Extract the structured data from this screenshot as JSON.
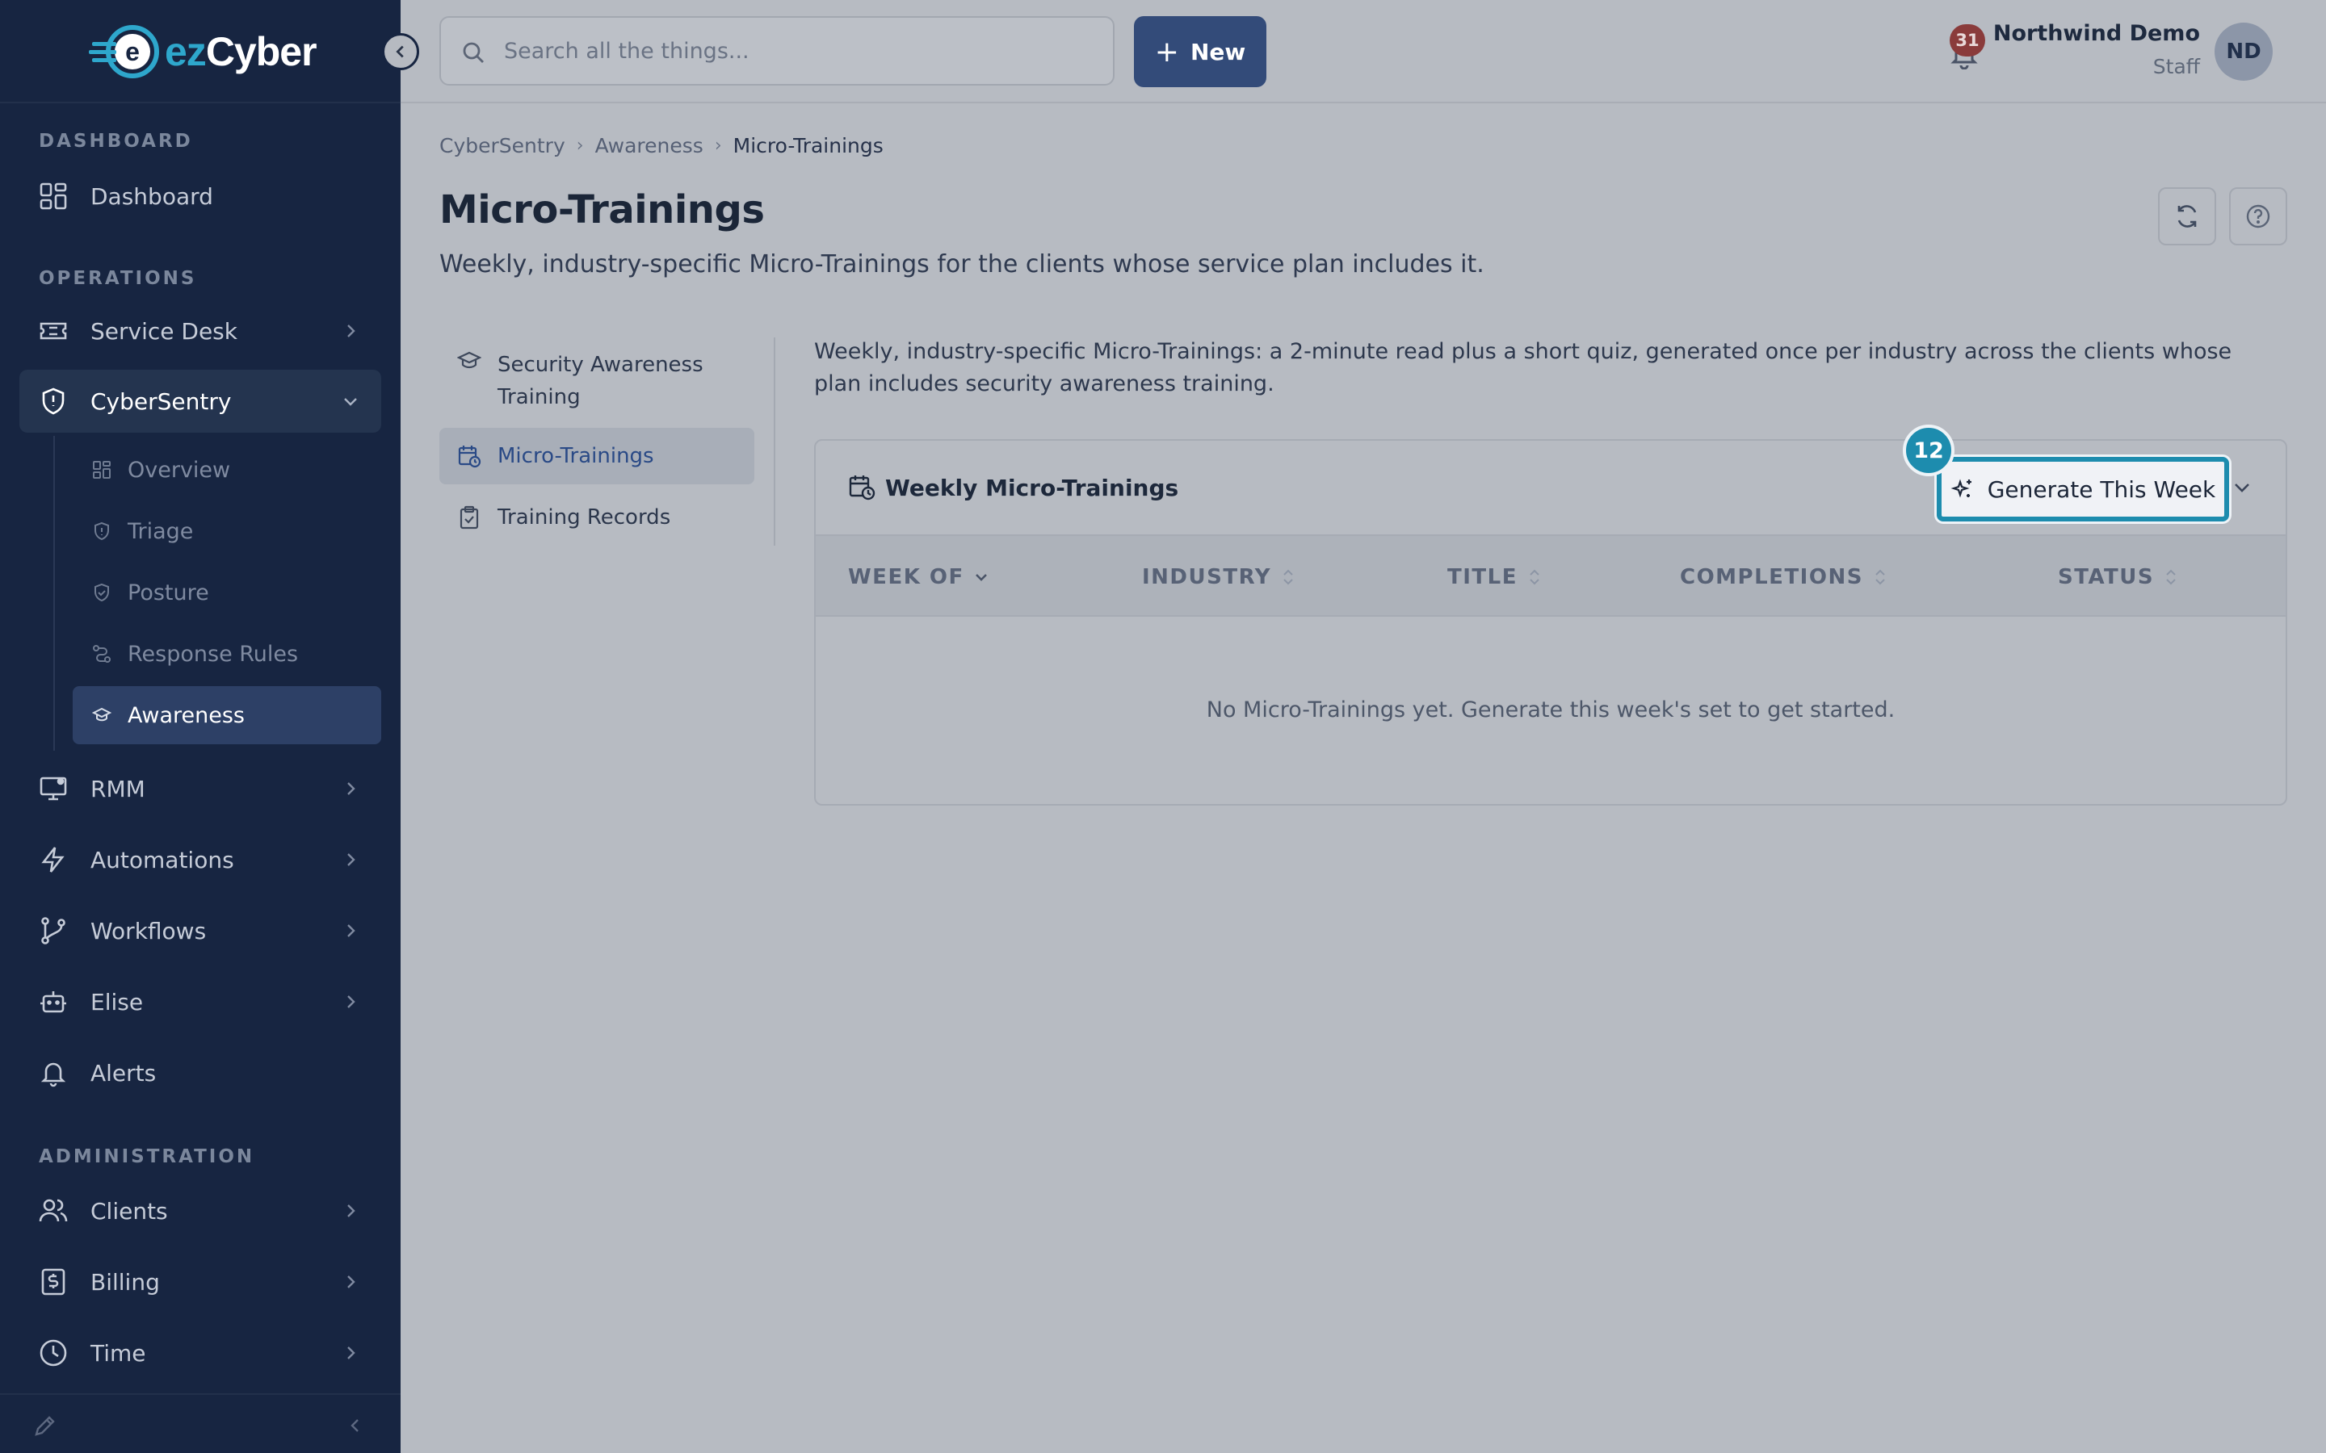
{
  "brand": {
    "logo_ez": "ez",
    "logo_cyber": "Cyber"
  },
  "sidebar": {
    "sections": {
      "dashboard": "DASHBOARD",
      "operations": "OPERATIONS",
      "administration": "ADMINISTRATION"
    },
    "items": {
      "dashboard": "Dashboard",
      "service_desk": "Service Desk",
      "cybersentry": "CyberSentry",
      "rmm": "RMM",
      "automations": "Automations",
      "workflows": "Workflows",
      "elise": "Elise",
      "alerts": "Alerts",
      "clients": "Clients",
      "billing": "Billing",
      "time": "Time"
    },
    "cybersentry_sub": {
      "overview": "Overview",
      "triage": "Triage",
      "posture": "Posture",
      "response_rules": "Response Rules",
      "awareness": "Awareness"
    }
  },
  "topbar": {
    "search_placeholder": "Search all the things...",
    "new_label": "New",
    "notification_count": "31",
    "user_name": "Northwind Demo",
    "user_role": "Staff",
    "avatar_initials": "ND"
  },
  "breadcrumb": [
    "CyberSentry",
    "Awareness",
    "Micro-Trainings"
  ],
  "page": {
    "title": "Micro-Trainings",
    "subtitle": "Weekly, industry-specific Micro-Trainings for the clients whose service plan includes it."
  },
  "subnav": {
    "security_awareness_line1": "Security Awareness",
    "security_awareness_line2": "Training",
    "micro_trainings": "Micro-Trainings",
    "training_records": "Training Records"
  },
  "content": {
    "description": "Weekly, industry-specific Micro-Trainings: a 2-minute read plus a short quiz, generated once per industry across the clients whose plan includes security awareness training.",
    "card_title": "Weekly Micro-Trainings",
    "generate_label": "Generate This Week",
    "step_number": "12",
    "columns": [
      "WEEK OF",
      "INDUSTRY",
      "TITLE",
      "COMPLETIONS",
      "STATUS"
    ],
    "empty_message": "No Micro-Trainings yet. Generate this week's set to get started."
  },
  "colors": {
    "accent": "#1d8cae",
    "sidebar_bg": "#172541",
    "primary_button": "#334b79"
  }
}
